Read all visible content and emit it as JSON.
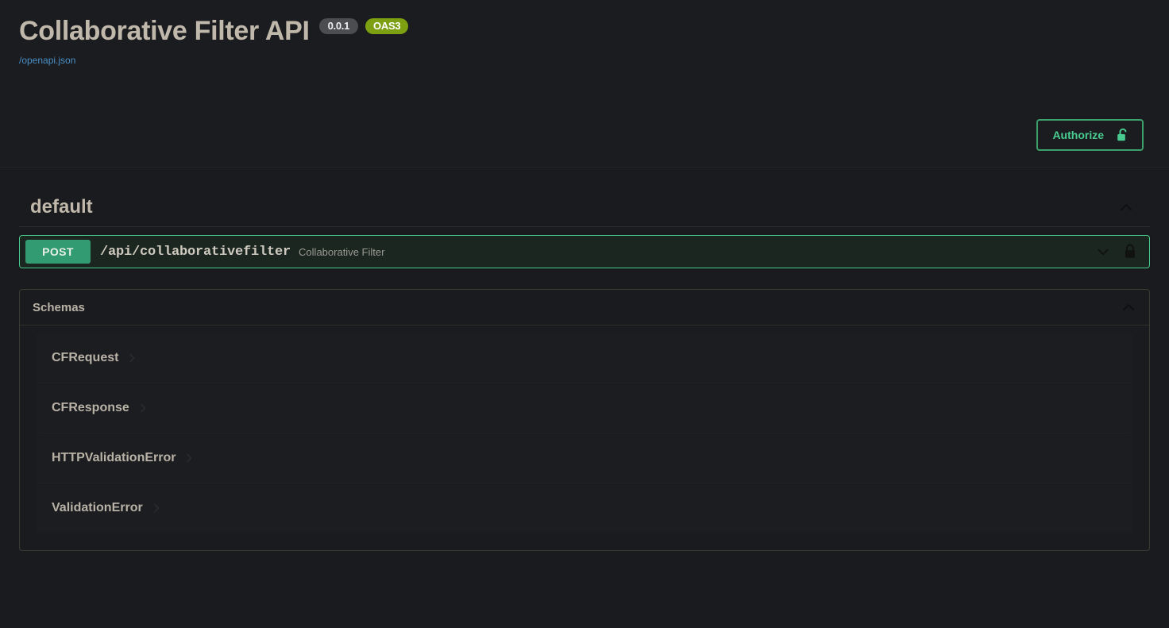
{
  "info": {
    "title": "Collaborative Filter API",
    "version_badge": "0.0.1",
    "spec_badge": "OAS3",
    "spec_url": "/openapi.json"
  },
  "auth": {
    "authorize_label": "Authorize",
    "lock_icon": "lock-open-icon"
  },
  "tags": [
    {
      "name": "default",
      "collapse_icon": "chevron-up-icon",
      "operations": [
        {
          "method": "POST",
          "path": "/api/collaborativefilter",
          "summary": "Collaborative Filter",
          "expand_icon": "chevron-down-icon",
          "auth_icon": "lock-closed-icon"
        }
      ]
    }
  ],
  "models": {
    "header": "Schemas",
    "collapse_icon": "chevron-up-icon",
    "items": [
      {
        "name": "CFRequest",
        "expand_icon": "chevron-right-icon"
      },
      {
        "name": "CFResponse",
        "expand_icon": "chevron-right-icon"
      },
      {
        "name": "HTTPValidationError",
        "expand_icon": "chevron-right-icon"
      },
      {
        "name": "ValidationError",
        "expand_icon": "chevron-right-icon"
      }
    ]
  },
  "colors": {
    "page_bg": "#1a1b1e",
    "post_green": "#339b72",
    "opblock_border": "#49cc90",
    "authorize_green": "#49cc90",
    "oas_badge": "#7d9f12",
    "version_badge": "#4b4d50",
    "link_blue": "#4990c7",
    "text_primary": "#c0b8ab"
  }
}
